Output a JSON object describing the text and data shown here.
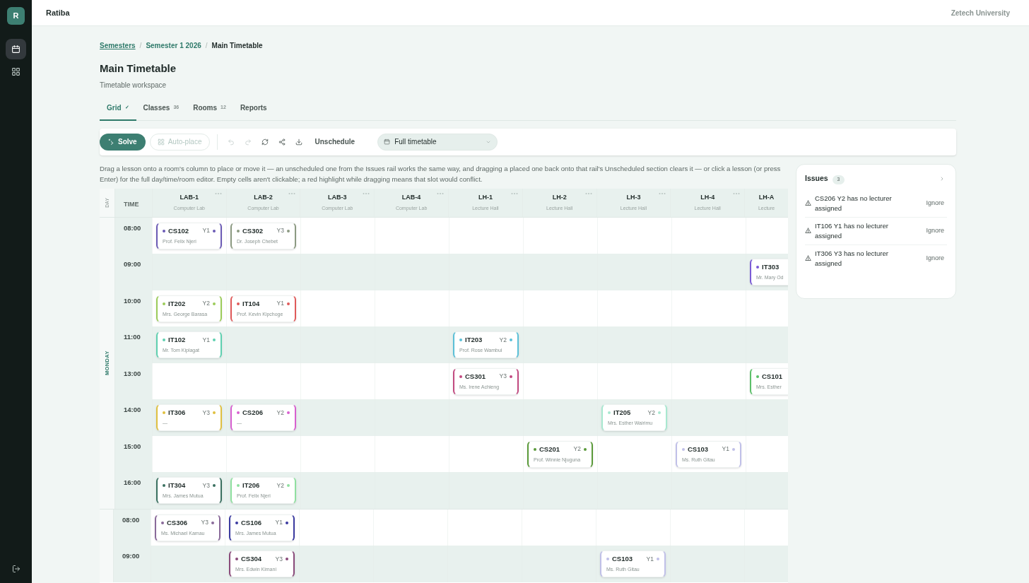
{
  "app": {
    "name": "Ratiba",
    "avatar": "R",
    "organization": "Zetech University"
  },
  "sidebar": {
    "items": [
      {
        "kind": "calendar",
        "selected": true
      },
      {
        "kind": "grid",
        "selected": false
      }
    ]
  },
  "breadcrumb_separator": "/",
  "breadcrumbs": [
    {
      "label": "Semesters",
      "kind": "link"
    },
    {
      "label": "Semester 1 2026",
      "kind": "link"
    },
    {
      "label": "Main Timetable",
      "kind": "current"
    }
  ],
  "page": {
    "title": "Main Timetable",
    "subtitle": "Timetable workspace"
  },
  "tabs": [
    {
      "label": "Grid",
      "badge": "✓",
      "selected": true
    },
    {
      "label": "Classes",
      "badge": "36",
      "selected": false
    },
    {
      "label": "Rooms",
      "badge": "12",
      "selected": false
    },
    {
      "label": "Reports",
      "selected": false
    }
  ],
  "toolbar": {
    "solve": "Solve",
    "autoplace": {
      "label": "Auto-place",
      "disabled": true
    },
    "undo_disabled": true,
    "redo_disabled": true,
    "unschedule": "Unschedule",
    "view": "Full timetable"
  },
  "hint": "Drag a lesson onto a room's column to place or move it — an unscheduled one from the Issues rail works the same way, and dragging a placed one back onto that rail's Unscheduled section clears it — or click a lesson (or press Enter) for the full day/time/room editor. Empty cells aren't clickable; a red highlight while dragging means that slot would conflict.",
  "grid": {
    "day_header": "DAY",
    "time_header": "TIME",
    "rooms": [
      {
        "code": "LAB-1",
        "type": "Computer Lab"
      },
      {
        "code": "LAB-2",
        "type": "Computer Lab"
      },
      {
        "code": "LAB-3",
        "type": "Computer Lab"
      },
      {
        "code": "LAB-4",
        "type": "Computer Lab"
      },
      {
        "code": "LH-1",
        "type": "Lecture Hall"
      },
      {
        "code": "LH-2",
        "type": "Lecture Hall"
      },
      {
        "code": "LH-3",
        "type": "Lecture Hall"
      },
      {
        "code": "LH-4",
        "type": "Lecture Hall"
      },
      {
        "code": "LH-A",
        "type": "Lecture"
      }
    ],
    "days": [
      {
        "label": "MONDAY",
        "rows": [
          {
            "time": "08:00",
            "cells": [
              {
                "kind": "lesson",
                "code": "CS102",
                "year": "Y1",
                "lecturer": "Prof. Felix Njeri",
                "color": "#6b5bb5"
              },
              {
                "kind": "lesson",
                "code": "CS302",
                "year": "Y3",
                "lecturer": "Dr. Joseph Chebet",
                "color": "#8c9a82"
              },
              {
                "kind": "empty"
              },
              {
                "kind": "empty"
              },
              {
                "kind": "empty"
              },
              {
                "kind": "empty"
              },
              {
                "kind": "empty"
              },
              {
                "kind": "empty"
              },
              {
                "kind": "empty"
              }
            ]
          },
          {
            "time": "09:00",
            "cells": [
              {
                "kind": "empty"
              },
              {
                "kind": "empty"
              },
              {
                "kind": "empty"
              },
              {
                "kind": "empty"
              },
              {
                "kind": "empty"
              },
              {
                "kind": "empty"
              },
              {
                "kind": "empty"
              },
              {
                "kind": "empty"
              },
              {
                "kind": "lesson",
                "code": "IT303",
                "lecturer": "Mr. Mary Od",
                "color": "#7b5bd6"
              }
            ]
          },
          {
            "time": "10:00",
            "cells": [
              {
                "kind": "lesson",
                "code": "IT202",
                "year": "Y2",
                "lecturer": "Mrs. George Barasa",
                "color": "#9ccc5a"
              },
              {
                "kind": "lesson",
                "code": "IT104",
                "year": "Y1",
                "lecturer": "Prof. Kevin Kipchoge",
                "color": "#e05a5a"
              },
              {
                "kind": "empty"
              },
              {
                "kind": "empty"
              },
              {
                "kind": "empty"
              },
              {
                "kind": "empty"
              },
              {
                "kind": "empty"
              },
              {
                "kind": "empty"
              },
              {
                "kind": "empty"
              }
            ]
          },
          {
            "time": "11:00",
            "cells": [
              {
                "kind": "lesson",
                "code": "IT102",
                "year": "Y1",
                "lecturer": "Mr. Tom Kiplagat",
                "color": "#5fd0b0"
              },
              {
                "kind": "empty"
              },
              {
                "kind": "empty"
              },
              {
                "kind": "empty"
              },
              {
                "kind": "lesson",
                "code": "IT203",
                "year": "Y2",
                "lecturer": "Prof. Rose Wambui",
                "color": "#5bc0d8"
              },
              {
                "kind": "empty"
              },
              {
                "kind": "empty"
              },
              {
                "kind": "empty"
              },
              {
                "kind": "empty"
              }
            ]
          },
          {
            "time": "13:00",
            "cells": [
              {
                "kind": "empty"
              },
              {
                "kind": "empty"
              },
              {
                "kind": "empty"
              },
              {
                "kind": "empty"
              },
              {
                "kind": "lesson",
                "code": "CS301",
                "year": "Y3",
                "lecturer": "Ms. Irene Achieng",
                "color": "#c24a80"
              },
              {
                "kind": "empty"
              },
              {
                "kind": "empty"
              },
              {
                "kind": "empty"
              },
              {
                "kind": "lesson",
                "code": "CS101",
                "lecturer": "Mrs. Esther",
                "color": "#5cc06a"
              }
            ]
          },
          {
            "time": "14:00",
            "cells": [
              {
                "kind": "lesson",
                "code": "IT306",
                "year": "Y3",
                "lecturer": "—",
                "color": "#e0c040"
              },
              {
                "kind": "lesson",
                "code": "CS206",
                "year": "Y2",
                "lecturer": "—",
                "color": "#d860d0"
              },
              {
                "kind": "empty"
              },
              {
                "kind": "empty"
              },
              {
                "kind": "empty"
              },
              {
                "kind": "empty"
              },
              {
                "kind": "lesson",
                "code": "IT205",
                "year": "Y2",
                "lecturer": "Mrs. Esther Wairimu",
                "color": "#a8e8d0"
              },
              {
                "kind": "empty"
              },
              {
                "kind": "empty"
              }
            ]
          },
          {
            "time": "15:00",
            "cells": [
              {
                "kind": "empty"
              },
              {
                "kind": "empty"
              },
              {
                "kind": "empty"
              },
              {
                "kind": "empty"
              },
              {
                "kind": "empty"
              },
              {
                "kind": "lesson",
                "code": "CS201",
                "year": "Y2",
                "lecturer": "Prof. Winnie Njuguna",
                "color": "#5a9a3a"
              },
              {
                "kind": "empty"
              },
              {
                "kind": "lesson",
                "code": "CS103",
                "year": "Y1",
                "lecturer": "Ms. Ruth Gitau",
                "color": "#c0c0e8"
              },
              {
                "kind": "empty"
              }
            ]
          },
          {
            "time": "16:00",
            "cells": [
              {
                "kind": "lesson",
                "code": "IT304",
                "year": "Y3",
                "lecturer": "Mrs. James Mutua",
                "color": "#3a7060"
              },
              {
                "kind": "lesson",
                "code": "IT206",
                "year": "Y2",
                "lecturer": "Prof. Felix Njeri",
                "color": "#90e0a0"
              },
              {
                "kind": "empty"
              },
              {
                "kind": "empty"
              },
              {
                "kind": "empty"
              },
              {
                "kind": "empty"
              },
              {
                "kind": "empty"
              },
              {
                "kind": "empty"
              },
              {
                "kind": "empty"
              }
            ]
          }
        ]
      },
      {
        "rows": [
          {
            "time": "08:00",
            "cells": [
              {
                "kind": "lesson",
                "code": "CS306",
                "year": "Y3",
                "lecturer": "Ms. Michael Kamau",
                "color": "#8a6a9a"
              },
              {
                "kind": "lesson",
                "code": "CS106",
                "year": "Y1",
                "lecturer": "Mrs. James Mutua",
                "color": "#3a3aa0"
              },
              {
                "kind": "empty"
              },
              {
                "kind": "empty"
              },
              {
                "kind": "empty"
              },
              {
                "kind": "empty"
              },
              {
                "kind": "empty"
              },
              {
                "kind": "empty"
              },
              {
                "kind": "empty"
              }
            ]
          },
          {
            "time": "09:00",
            "cells": [
              {
                "kind": "empty"
              },
              {
                "kind": "lesson",
                "code": "CS304",
                "year": "Y3",
                "lecturer": "Mrs. Edwin Kimani",
                "color": "#8a4a7a"
              },
              {
                "kind": "empty"
              },
              {
                "kind": "empty"
              },
              {
                "kind": "empty"
              },
              {
                "kind": "empty"
              },
              {
                "kind": "lesson",
                "code": "CS103",
                "year": "Y1",
                "lecturer": "Ms. Ruth Gitau",
                "color": "#c0c0e8"
              },
              {
                "kind": "empty"
              },
              {
                "kind": "empty"
              }
            ]
          }
        ]
      }
    ]
  },
  "issues": {
    "title": "Issues",
    "count": "3",
    "items": [
      {
        "text": "CS206 Y2 has no lecturer assigned",
        "action": "Ignore"
      },
      {
        "text": "IT106 Y1 has no lecturer assigned",
        "action": "Ignore"
      },
      {
        "text": "IT306 Y3 has no lecturer assigned",
        "action": "Ignore"
      }
    ]
  }
}
